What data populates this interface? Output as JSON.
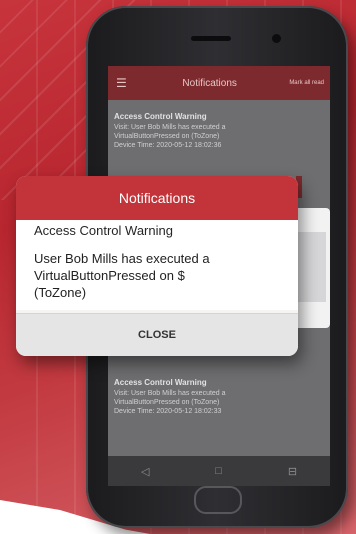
{
  "app": {
    "header_title": "Notifications",
    "mark_all_label": "Mark all read",
    "menu_icon": "hamburger-icon"
  },
  "background_notifications": [
    {
      "title": "Access Control Warning",
      "line1": "Visit: User Bob Mills has executed a",
      "line2": "VirtualButtonPressed on (ToZone)",
      "time": "Device Time: 2020-05-12 18:02:36"
    },
    {
      "title": "Access Control Warning",
      "line1": "Visit: User Bob Mills has executed a",
      "line2": "VirtualButtonPressed on (ToZone)",
      "time": "Device Time: 2020-05-12 18:02:33"
    }
  ],
  "dialog": {
    "title": "Notifications",
    "subtitle": "Access Control Warning",
    "message": "User Bob Mills has executed a VirtualButtonPressed on $ (ToZone)",
    "close_label": "CLOSE"
  },
  "nav": {
    "back_icon": "back-triangle-icon",
    "home_icon": "home-square-icon",
    "recents_icon": "recents-icon"
  },
  "colors": {
    "brand_red": "#c23439",
    "header_dark_red": "#7d2a2e"
  }
}
